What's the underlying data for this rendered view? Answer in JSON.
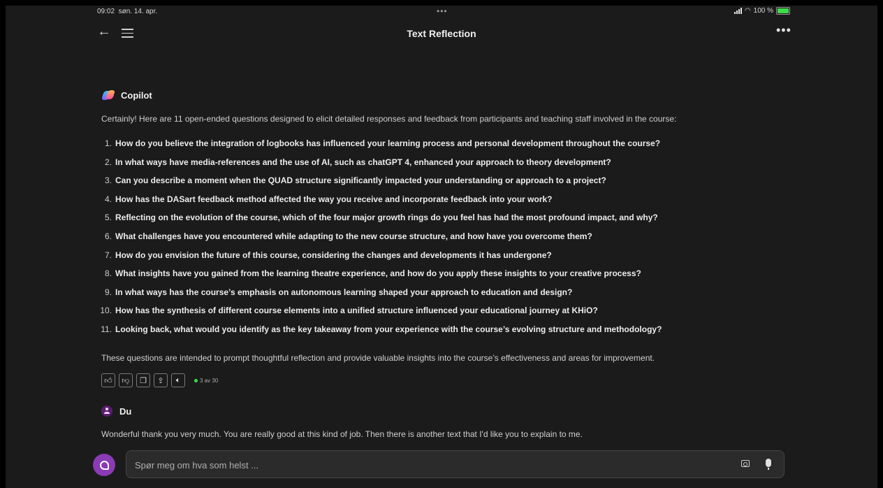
{
  "status": {
    "time": "09:02",
    "date": "søn. 14. apr.",
    "battery": "100 %"
  },
  "header": {
    "title": "Text Reflection"
  },
  "copilot": {
    "name": "Copilot",
    "intro": "Certainly! Here are 11 open-ended questions designed to elicit detailed responses and feedback from participants and teaching staff involved in the course:",
    "questions": [
      "How do you believe the integration of logbooks has influenced your learning process and personal development throughout the course?",
      "In what ways have media-references and the use of AI, such as chatGPT 4, enhanced your approach to theory development?",
      "Can you describe a moment when the QUAD structure significantly impacted your understanding or approach to a project?",
      "How has the DASart feedback method affected the way you receive and incorporate feedback into your work?",
      "Reflecting on the evolution of the course, which of the four major growth rings do you feel has had the most profound impact, and why?",
      "What challenges have you encountered while adapting to the new course structure, and how have you overcome them?",
      "How do you envision the future of this course, considering the changes and developments it has undergone?",
      "What insights have you gained from the learning theatre experience, and how do you apply these insights to your creative process?",
      "In what ways has the course’s emphasis on autonomous learning shaped your approach to education and design?",
      "How has the synthesis of different course elements into a unified structure influenced your educational journey at KHiO?",
      "Looking back, what would you identify as the key takeaway from your experience with the course’s evolving structure and methodology?"
    ],
    "outro": "These questions are intended to prompt thoughtful reflection and provide valuable insights into the course’s effectiveness and areas for improvement.",
    "turn_count": "3 av 30"
  },
  "user": {
    "name": "Du",
    "message": "Wonderful thank you very much. You are really good at this kind of job. Then there is another text that I'd like you to explain to me."
  },
  "composer": {
    "placeholder": "Spør meg om hva som helst ..."
  },
  "colors": {
    "background": "#1b1b1b",
    "accent": "#8a3bb5",
    "online": "#3ddc4a"
  }
}
